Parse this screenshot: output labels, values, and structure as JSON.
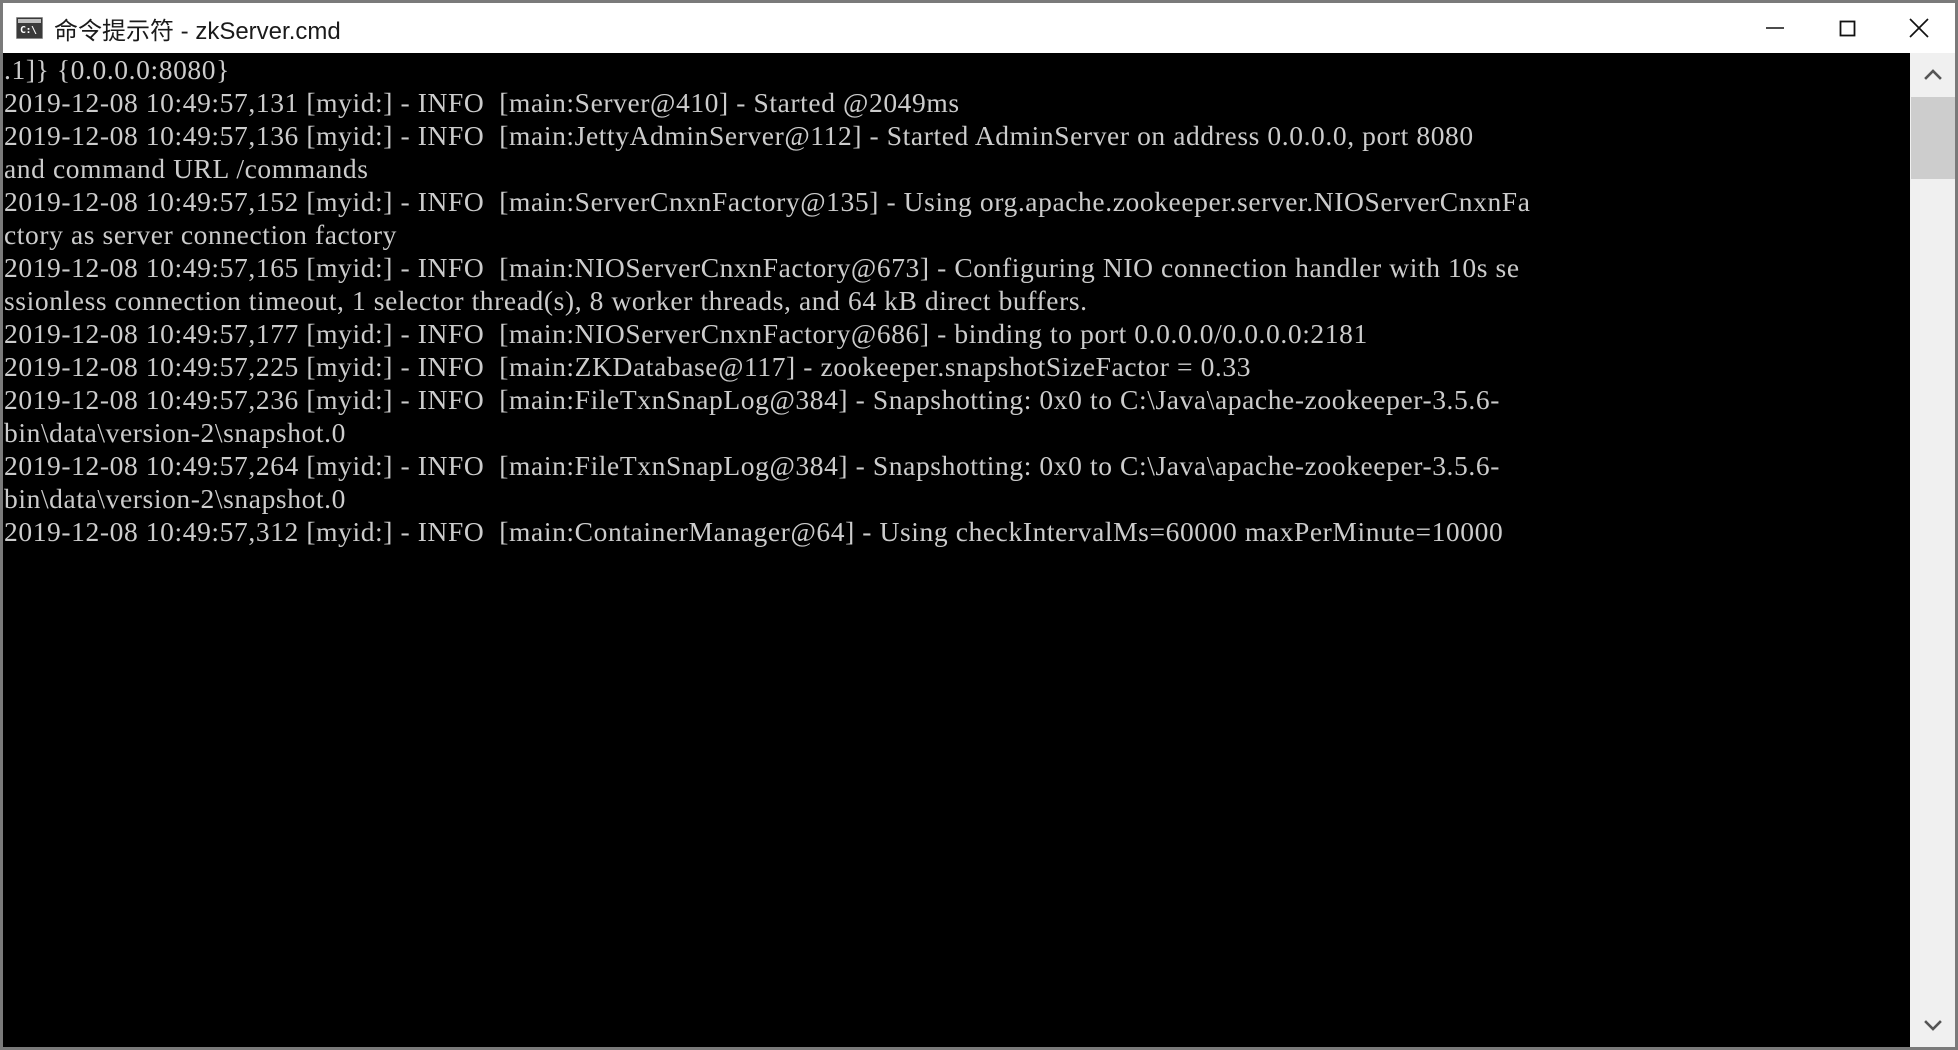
{
  "window": {
    "title": "命令提示符 - zkServer.cmd",
    "icon": "cmd-console-icon",
    "icon_prompt": "C:\\",
    "colors": {
      "titlebar_bg": "#ffffff",
      "console_bg": "#000000",
      "console_fg": "#cccccc",
      "window_border": "#7a7a7a",
      "scrollbar_track": "#f0f0f0",
      "scrollbar_thumb": "#cdcdcd"
    },
    "controls": {
      "minimize": {
        "name": "minimize-button",
        "glyph": "—"
      },
      "maximize": {
        "name": "maximize-button",
        "glyph": "□"
      },
      "close": {
        "name": "close-button",
        "glyph": "✕"
      }
    }
  },
  "console": {
    "lines": [
      ".1]} {0.0.0.0:8080}",
      "2019-12-08 10:49:57,131 [myid:] - INFO  [main:Server@410] - Started @2049ms",
      "2019-12-08 10:49:57,136 [myid:] - INFO  [main:JettyAdminServer@112] - Started AdminServer on address 0.0.0.0, port 8080",
      "and command URL /commands",
      "2019-12-08 10:49:57,152 [myid:] - INFO  [main:ServerCnxnFactory@135] - Using org.apache.zookeeper.server.NIOServerCnxnFa",
      "ctory as server connection factory",
      "2019-12-08 10:49:57,165 [myid:] - INFO  [main:NIOServerCnxnFactory@673] - Configuring NIO connection handler with 10s se",
      "ssionless connection timeout, 1 selector thread(s), 8 worker threads, and 64 kB direct buffers.",
      "2019-12-08 10:49:57,177 [myid:] - INFO  [main:NIOServerCnxnFactory@686] - binding to port 0.0.0.0/0.0.0.0:2181",
      "2019-12-08 10:49:57,225 [myid:] - INFO  [main:ZKDatabase@117] - zookeeper.snapshotSizeFactor = 0.33",
      "2019-12-08 10:49:57,236 [myid:] - INFO  [main:FileTxnSnapLog@384] - Snapshotting: 0x0 to C:\\Java\\apache-zookeeper-3.5.6-",
      "bin\\data\\version-2\\snapshot.0",
      "2019-12-08 10:49:57,264 [myid:] - INFO  [main:FileTxnSnapLog@384] - Snapshotting: 0x0 to C:\\Java\\apache-zookeeper-3.5.6-",
      "bin\\data\\version-2\\snapshot.0",
      "2019-12-08 10:49:57,312 [myid:] - INFO  [main:ContainerManager@64] - Using checkIntervalMs=60000 maxPerMinute=10000"
    ],
    "text": ".1]} {0.0.0.0:8080}\n2019-12-08 10:49:57,131 [myid:] - INFO  [main:Server@410] - Started @2049ms\n2019-12-08 10:49:57,136 [myid:] - INFO  [main:JettyAdminServer@112] - Started AdminServer on address 0.0.0.0, port 8080\nand command URL /commands\n2019-12-08 10:49:57,152 [myid:] - INFO  [main:ServerCnxnFactory@135] - Using org.apache.zookeeper.server.NIOServerCnxnFa\nctory as server connection factory\n2019-12-08 10:49:57,165 [myid:] - INFO  [main:NIOServerCnxnFactory@673] - Configuring NIO connection handler with 10s se\nssionless connection timeout, 1 selector thread(s), 8 worker threads, and 64 kB direct buffers.\n2019-12-08 10:49:57,177 [myid:] - INFO  [main:NIOServerCnxnFactory@686] - binding to port 0.0.0.0/0.0.0.0:2181\n2019-12-08 10:49:57,225 [myid:] - INFO  [main:ZKDatabase@117] - zookeeper.snapshotSizeFactor = 0.33\n2019-12-08 10:49:57,236 [myid:] - INFO  [main:FileTxnSnapLog@384] - Snapshotting: 0x0 to C:\\Java\\apache-zookeeper-3.5.6-\nbin\\data\\version-2\\snapshot.0\n2019-12-08 10:49:57,264 [myid:] - INFO  [main:FileTxnSnapLog@384] - Snapshotting: 0x0 to C:\\Java\\apache-zookeeper-3.5.6-\nbin\\data\\version-2\\snapshot.0\n2019-12-08 10:49:57,312 [myid:] - INFO  [main:ContainerManager@64] - Using checkIntervalMs=60000 maxPerMinute=10000"
  },
  "scrollbar": {
    "up_arrow": "scroll-up-arrow",
    "down_arrow": "scroll-down-arrow",
    "thumb": "scroll-thumb"
  }
}
